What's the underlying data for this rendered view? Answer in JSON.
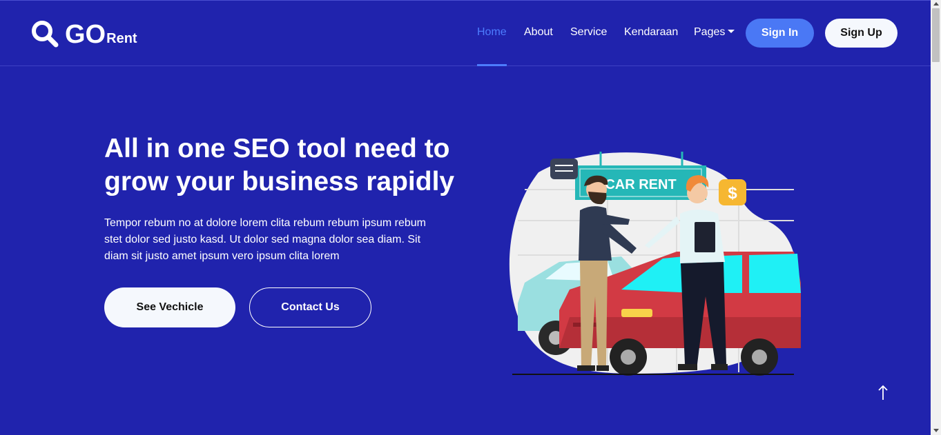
{
  "logo": {
    "brand": "GO",
    "suffix": "Rent",
    "icon": "search-icon"
  },
  "nav": {
    "items": [
      {
        "label": "Home",
        "active": true
      },
      {
        "label": "About",
        "active": false
      },
      {
        "label": "Service",
        "active": false
      },
      {
        "label": "Kendaraan",
        "active": false
      },
      {
        "label": "Pages",
        "active": false,
        "dropdown": true
      }
    ],
    "sign_in": "Sign In",
    "sign_up": "Sign Up"
  },
  "hero": {
    "title": "All in one SEO tool need to grow your business rapidly",
    "text": "Tempor rebum no at dolore lorem clita rebum rebum ipsum rebum stet dolor sed justo kasd. Ut dolor sed magna dolor sea diam. Sit diam sit justo amet ipsum vero ipsum clita lorem",
    "primary_button": "See Vechicle",
    "secondary_button": "Contact Us",
    "illustration_sign": "CAR RENT",
    "illustration_coin": "$"
  },
  "back_to_top": {
    "icon": "arrow-up-icon"
  },
  "colors": {
    "background": "#2023ad",
    "accent": "#4a78f5",
    "active_link": "#4d7dff",
    "button_light": "#f5f8fd"
  }
}
